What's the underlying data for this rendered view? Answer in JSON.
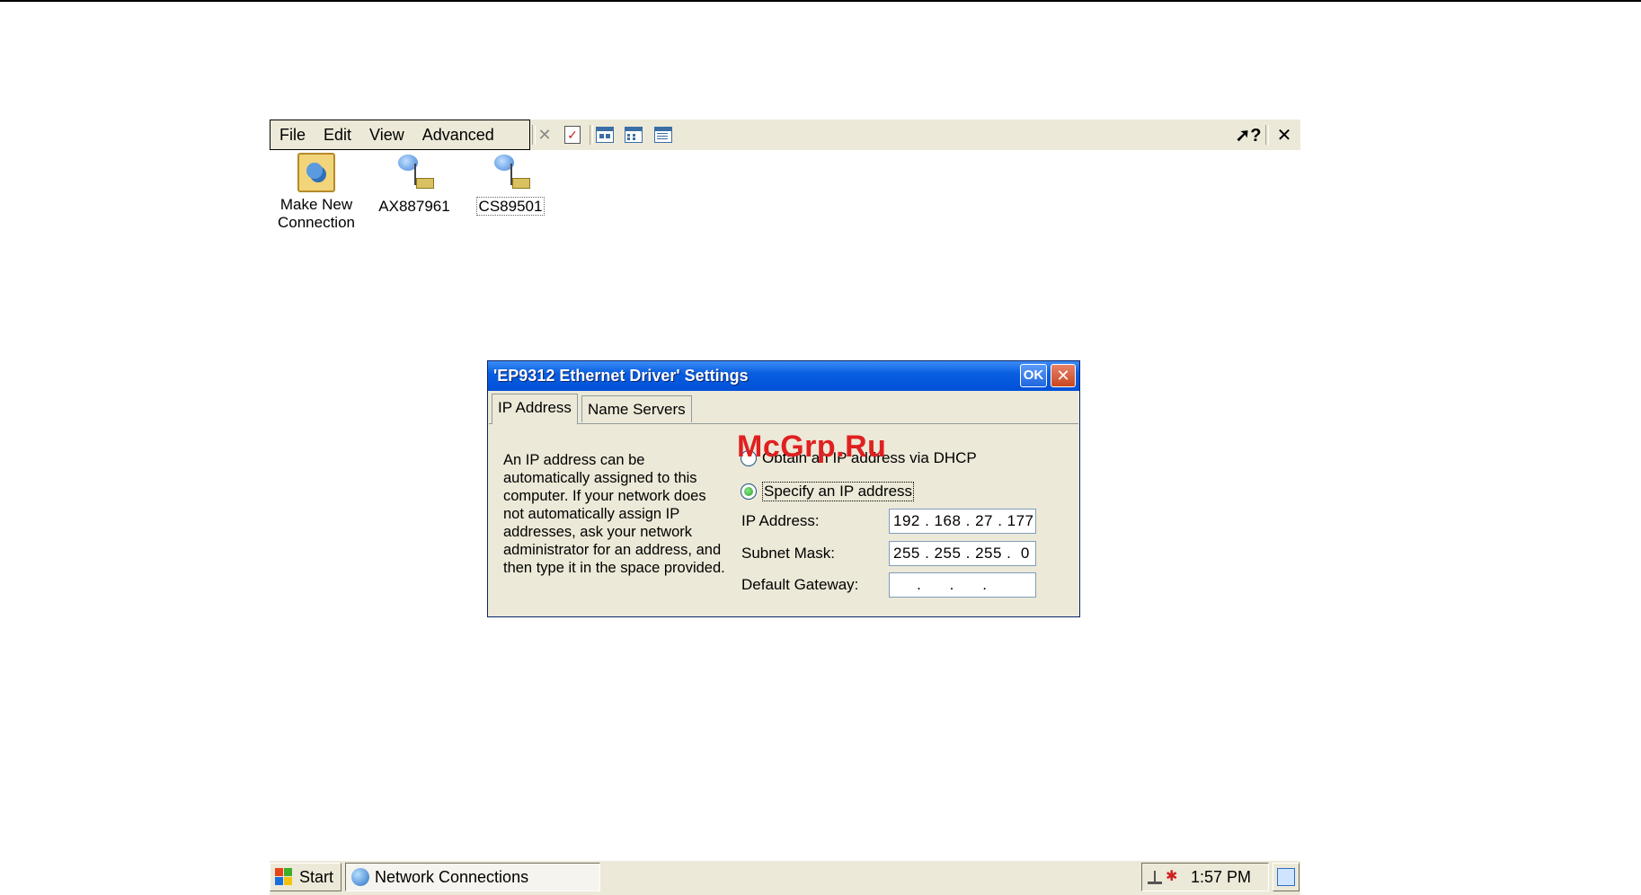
{
  "menubar": {
    "items": [
      "File",
      "Edit",
      "View",
      "Advanced"
    ]
  },
  "toolbar_icons": {
    "delete": "delete-x-icon",
    "properties": "properties-check-icon",
    "large_icons": "view-large-icons-icon",
    "small_icons": "view-small-icons-icon",
    "details": "view-details-icon",
    "help": "help-cursor-icon",
    "close": "close-icon"
  },
  "desktop_icons": [
    {
      "label": "Make New Connection",
      "icon": "connection-wizard-icon"
    },
    {
      "label": "AX887961",
      "icon": "network-connection-icon"
    },
    {
      "label": "CS89501",
      "icon": "network-connection-icon"
    }
  ],
  "dialog": {
    "title": "'EP9312 Ethernet Driver' Settings",
    "ok_label": "OK",
    "close_label": "✕",
    "tabs": [
      "IP Address",
      "Name Servers"
    ],
    "description": "An IP address can be automatically assigned to this computer.  If your network does not automatically assign IP addresses, ask your network administrator for an address, and then type it in the space provided.",
    "radio_dhcp": "Obtain an IP address via DHCP",
    "radio_specify": "Specify an IP address",
    "selected_radio": "specify",
    "ip_label": "IP Address:",
    "ip_value": "192 . 168 . 27 . 177",
    "subnet_label": "Subnet Mask:",
    "subnet_value": "255 . 255 . 255 .  0",
    "gateway_label": "Default Gateway:",
    "gateway_value": "     .      .      ."
  },
  "watermark": "McGrp.Ru",
  "taskbar": {
    "start_label": "Start",
    "task_label": "Network Connections",
    "clock": "1:57 PM"
  }
}
